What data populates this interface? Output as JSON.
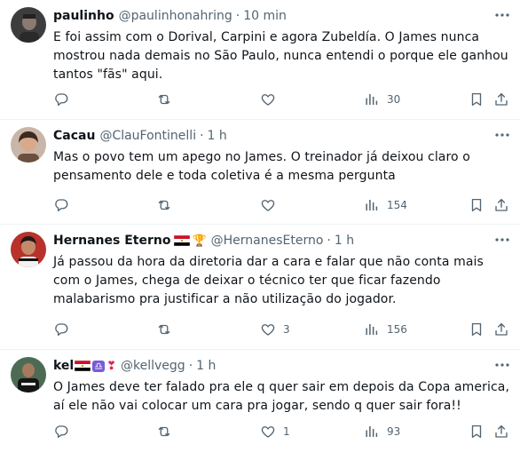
{
  "tweets": [
    {
      "name": "paulinho",
      "handle": "@paulinhonahring",
      "time": "10 min",
      "text": "E foi assim com o Dorival, Carpini e agora Zubeldía. O James nunca mostrou nada demais no São Paulo, nunca entendi o porque ele ganhou tantos \"fãs\" aqui.",
      "likes": "",
      "views": "30"
    },
    {
      "name": "Cacau",
      "handle": "@ClauFontinelli",
      "time": "1 h",
      "text": "Mas o povo tem um apego no James. O treinador já deixou claro o pensamento dele e toda coletiva é a mesma pergunta",
      "likes": "",
      "views": "154"
    },
    {
      "name": "Hernanes Eterno",
      "handle": "@HernanesEterno",
      "time": "1 h",
      "text": "Já passou da hora da diretoria dar a cara e falar que não conta mais com o James, chega de deixar o técnico ter que ficar fazendo malabarismo pra justificar a não utilização do jogador.",
      "likes": "3",
      "views": "156"
    },
    {
      "name": "kel",
      "handle": "@kellvegg",
      "time": "1 h",
      "text": "O James deve ter falado pra ele q quer sair em depois da Copa america, aí ele não vai colocar um cara pra jogar, sendo q quer sair fora!!",
      "likes": "1",
      "views": "93"
    }
  ],
  "symbols": {
    "separator": "·",
    "trophy": "🏆",
    "libra": "♎",
    "heart": "❣"
  },
  "icons": [
    "more-icon",
    "reply-icon",
    "retweet-icon",
    "like-icon",
    "views-icon",
    "bookmark-icon",
    "share-icon"
  ]
}
